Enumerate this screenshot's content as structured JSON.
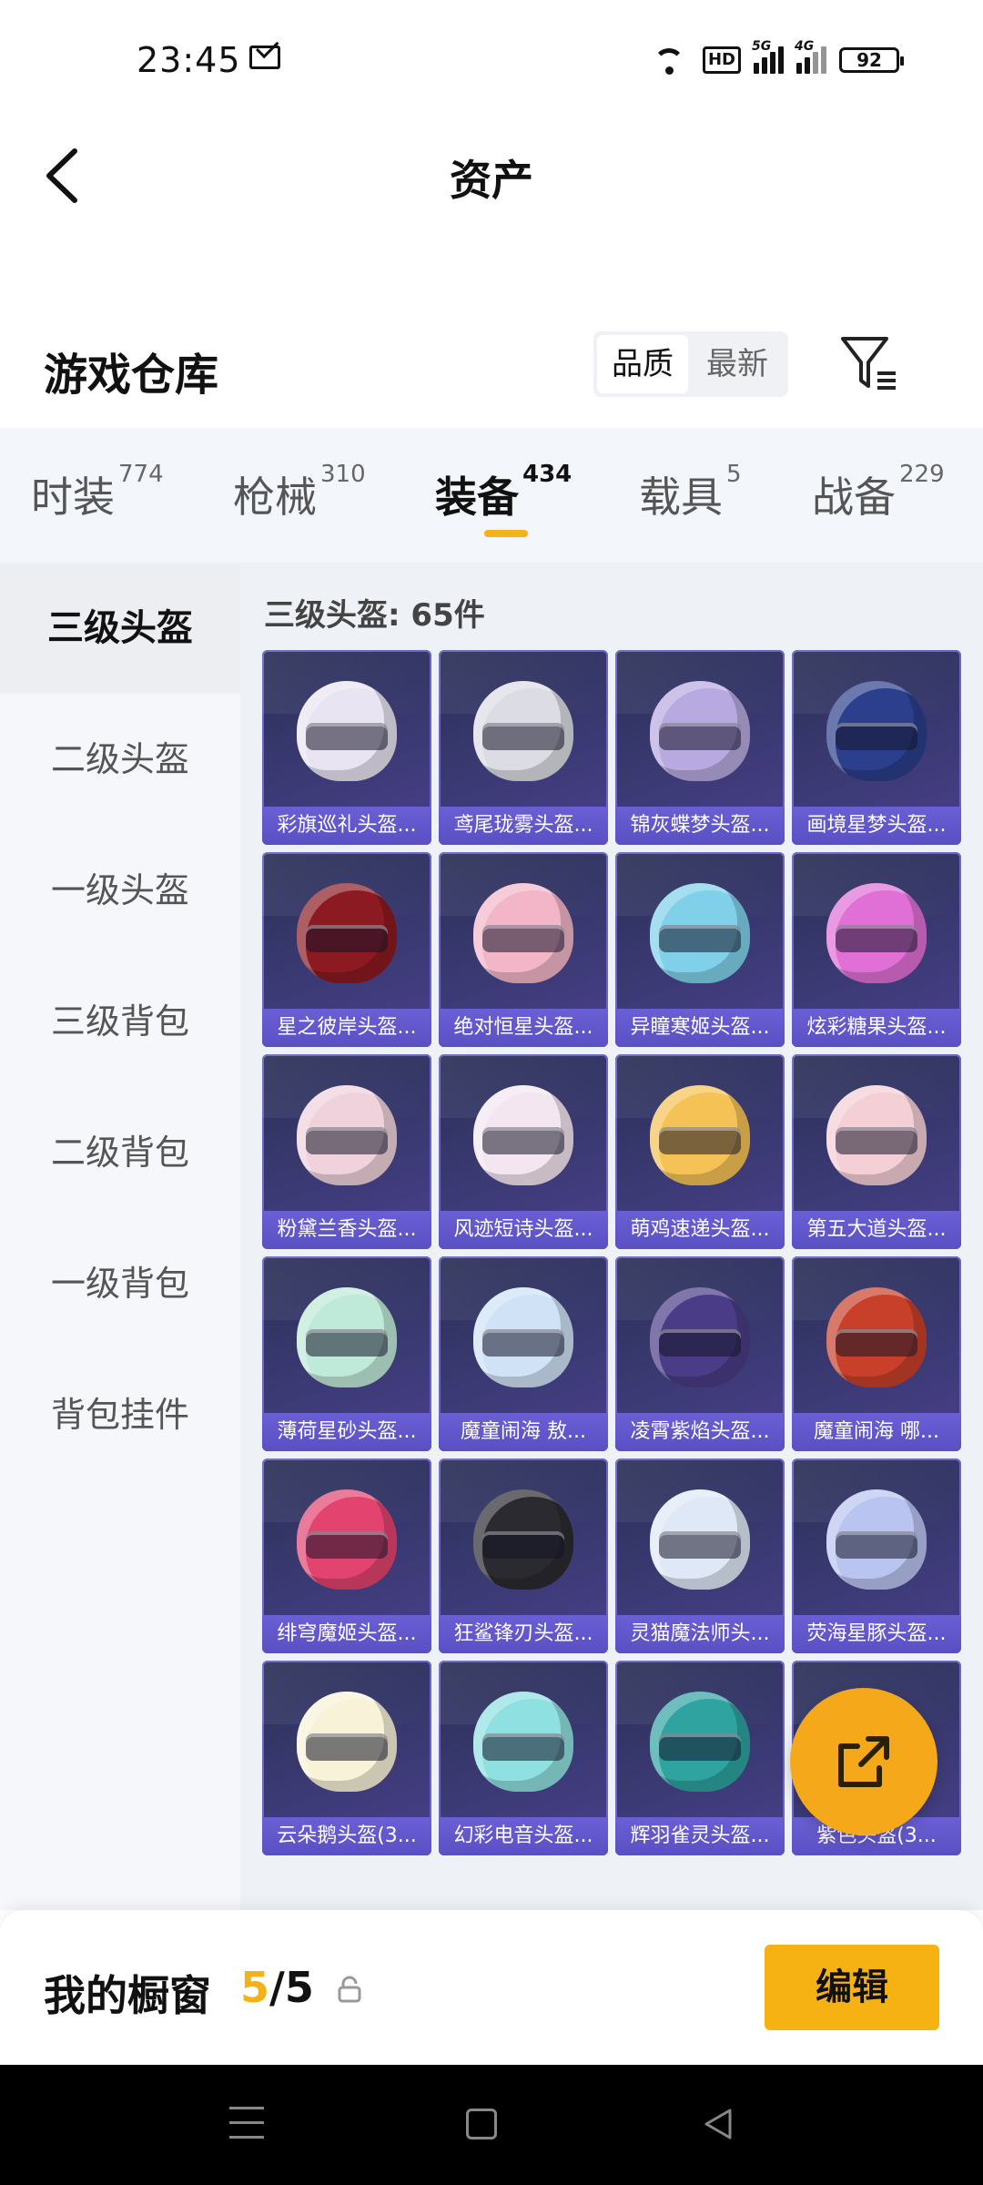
{
  "status_bar": {
    "time": "23:45",
    "hd_label": "HD",
    "sig1_label": "5G",
    "sig2_label": "4G",
    "battery": "92"
  },
  "header": {
    "title": "资产"
  },
  "section": {
    "title": "游戏仓库",
    "sort_options": [
      "品质",
      "最新"
    ]
  },
  "categories": [
    {
      "label": "时装",
      "count": "774"
    },
    {
      "label": "枪械",
      "count": "310"
    },
    {
      "label": "装备",
      "count": "434"
    },
    {
      "label": "载具",
      "count": "5"
    },
    {
      "label": "战备",
      "count": "229"
    }
  ],
  "side_menu": [
    "三级头盔",
    "二级头盔",
    "一级头盔",
    "三级背包",
    "二级背包",
    "一级背包",
    "背包挂件"
  ],
  "grid": {
    "heading": "三级头盔: 65件",
    "items": [
      {
        "label": "彩旗巡礼头盔...",
        "color": "#e8e4f2"
      },
      {
        "label": "鸢尾珑雾头盔...",
        "color": "#dcdce4"
      },
      {
        "label": "锦灰蝶梦头盔...",
        "color": "#b8a9e0"
      },
      {
        "label": "画境星梦头盔...",
        "color": "#2b3f8c"
      },
      {
        "label": "星之彼岸头盔...",
        "color": "#8c1a22"
      },
      {
        "label": "绝对恒星头盔...",
        "color": "#f2b6c8"
      },
      {
        "label": "异瞳寒姬头盔...",
        "color": "#7fd0e8"
      },
      {
        "label": "炫彩糖果头盔...",
        "color": "#e06fd6"
      },
      {
        "label": "粉黛兰香头盔...",
        "color": "#f0d2dc"
      },
      {
        "label": "风迹短诗头盔...",
        "color": "#f4e6f0"
      },
      {
        "label": "萌鸡速递头盔...",
        "color": "#f5c256"
      },
      {
        "label": "第五大道头盔...",
        "color": "#f4cfd6"
      },
      {
        "label": "薄荷星砂头盔...",
        "color": "#bfe9d8"
      },
      {
        "label": "魔童闹海 敖...",
        "color": "#cfe2f6"
      },
      {
        "label": "凌霄紫焰头盔...",
        "color": "#4a3c86"
      },
      {
        "label": "魔童闹海 哪...",
        "color": "#c8402a"
      },
      {
        "label": "绯穹魔姬头盔...",
        "color": "#e2436f"
      },
      {
        "label": "狂鲨锋刃头盔...",
        "color": "#2a2a30"
      },
      {
        "label": "灵猫魔法师头...",
        "color": "#dfe8f6"
      },
      {
        "label": "荧海星豚头盔...",
        "color": "#b9c4f0"
      },
      {
        "label": "云朵鹅头盔(3...",
        "color": "#f7f2d8"
      },
      {
        "label": "幻彩电音头盔...",
        "color": "#8fe0e0"
      },
      {
        "label": "辉羽雀灵头盔...",
        "color": "#2ea3a0"
      },
      {
        "label": "紫色头盔(3...",
        "color": "#e8e6f0"
      }
    ]
  },
  "showcase": {
    "label": "我的橱窗",
    "current": "5",
    "separator": "/",
    "total": "5",
    "edit_label": "编辑"
  }
}
